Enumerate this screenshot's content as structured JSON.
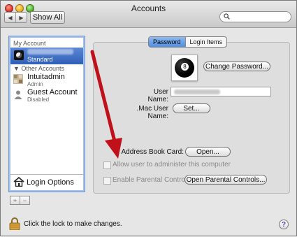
{
  "window": {
    "title": "Accounts",
    "show_all": "Show All",
    "search_placeholder": ""
  },
  "sidebar": {
    "my_account_header": "My Account",
    "current_user_role": "Standard",
    "other_accounts_header": "Other Accounts",
    "users": [
      {
        "name": "Intuitadmin",
        "role": "Admin"
      },
      {
        "name": "Guest Account",
        "role": "Disabled"
      }
    ],
    "login_options": "Login Options",
    "add": "+",
    "remove": "−"
  },
  "tabs": [
    "Password",
    "Login Items"
  ],
  "form": {
    "change_password": "Change Password...",
    "user_name_label": "User Name:",
    "mac_user_label": ".Mac User Name:",
    "set_button": "Set...",
    "address_book_label": "Address Book Card:",
    "open_button": "Open...",
    "allow_admin": "Allow user to administer this computer",
    "parental_controls": "Enable Parental Controls",
    "open_parental": "Open Parental Controls..."
  },
  "footer": {
    "lock_text": "Click the lock to make changes.",
    "help": "?"
  },
  "colors": {
    "selection": "#3f6fc4",
    "arrow": "#c0111a"
  }
}
